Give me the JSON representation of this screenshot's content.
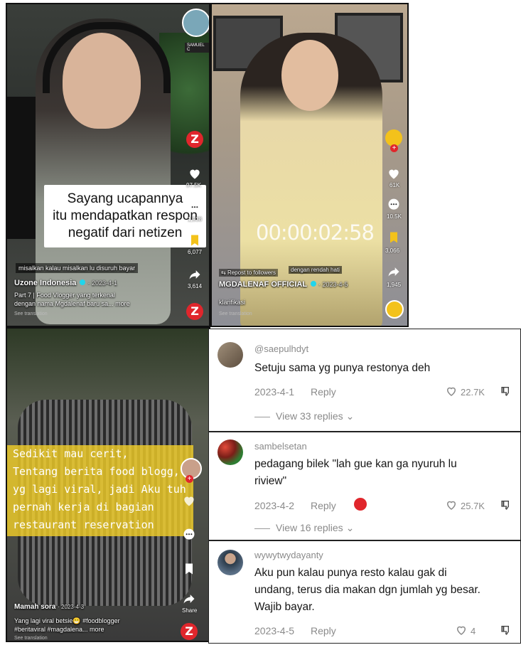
{
  "panel1": {
    "caption_lines": [
      "Sayang ucapannya",
      "itu mendapatkan respon",
      "negatif dari netizen"
    ],
    "subtitle": "misalkan kalau misalkan lu disuruh bayar",
    "username": "Uzone Indonesia",
    "date": "· 2023-4-1",
    "description_line1": "Part 7 | Food Vlogger yang terkenal",
    "description_line2": "dengan nama Mgdalenaf baru sa... more",
    "see_translation": "See translation",
    "top_badge": "SAMUEL C",
    "counts": {
      "likes": "97.5K",
      "comments": "1,938",
      "saves": "6,077",
      "shares": "3,614"
    }
  },
  "panel2": {
    "timer": "00:00:02:58",
    "repost": "Repost to followers",
    "subtitle": "dengan rendah hati",
    "username": "MGDALENAF OFFICIAL",
    "date": "· 2023-4-5",
    "description": "klarifikasi",
    "see_translation": "See translation",
    "counts": {
      "likes": "61K",
      "comments": "10.5K",
      "saves": "3,066",
      "shares": "1,945"
    }
  },
  "panel3": {
    "overlay_lines": [
      "Sedikit mau cerit,",
      "Tentang berita food blogg,",
      "yg lagi viral, jadi Aku tuh",
      "pernah kerja di bagian",
      "restaurant reservation"
    ],
    "username": "Mamah sora",
    "date": "· 2023-4-3",
    "description_line1": "Yang lagi viral betsie😁 #foodblogger",
    "description_line2": "#beritaviral #magdalena... more",
    "see_translation": "See translation",
    "share_label": "Share"
  },
  "comments": [
    {
      "username": "@saepulhdyt",
      "text_lines": [
        "Setuju sama yg punya restonya deh"
      ],
      "date": "2023-4-1",
      "reply_label": "Reply",
      "likes": "22.7K",
      "view_replies": "View 33 replies"
    },
    {
      "username": "sambelsetan",
      "text_lines": [
        "pedagang bilek \"lah gue kan ga nyuruh lu",
        "riview\""
      ],
      "date": "2023-4-2",
      "reply_label": "Reply",
      "likes": "25.7K",
      "view_replies": "View 16 replies"
    },
    {
      "username": "wywytwydayanty",
      "text_lines": [
        "Aku pun kalau punya resto kalau gak di",
        "undang, terus dia makan dgn jumlah yg besar.",
        "Wajib bayar."
      ],
      "date": "2023-4-5",
      "reply_label": "Reply",
      "likes": "4"
    }
  ],
  "colors": {
    "brand_red": "#e0262c",
    "caption_yellow": "#f0cd28",
    "meta_grey": "#8a8a8a"
  }
}
